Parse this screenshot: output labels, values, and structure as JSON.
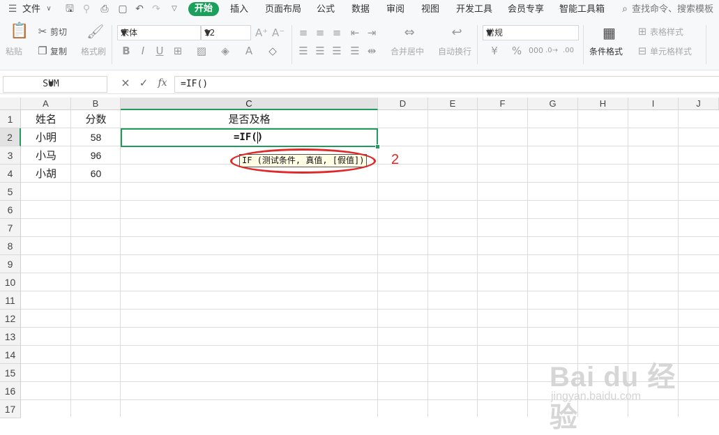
{
  "menu": {
    "file_label": "文件",
    "tabs": [
      "开始",
      "插入",
      "页面布局",
      "公式",
      "数据",
      "审阅",
      "视图",
      "开发工具",
      "会员专享",
      "智能工具箱"
    ],
    "search_placeholder": "查找命令、搜索模板"
  },
  "ribbon": {
    "paste": "粘贴",
    "cut": "剪切",
    "copy": "复制",
    "format_painter": "格式刷",
    "font_name": "宋体",
    "font_size": "12",
    "merge_center": "合并居中",
    "wrap_text": "自动换行",
    "number_format": "常规",
    "conditional_format": "条件格式",
    "table_style": "表格样式",
    "cell_style": "单元格样式"
  },
  "formula_bar": {
    "name_box": "SUM",
    "cancel_icon": "×",
    "enter_icon": "✓",
    "fx_icon": "fx",
    "content": "=IF()"
  },
  "sheet": {
    "columns": [
      "A",
      "B",
      "C",
      "D",
      "E",
      "F",
      "G",
      "H",
      "I",
      "J"
    ],
    "selected_column": "C",
    "rows": [
      "1",
      "2",
      "3",
      "4",
      "5",
      "6",
      "7",
      "8",
      "9",
      "10",
      "11",
      "12",
      "13",
      "14",
      "15",
      "16",
      "17"
    ],
    "selected_row": "2",
    "cells": {
      "A1": "姓名",
      "B1": "分数",
      "C1": "是否及格",
      "A2": "小明",
      "B2": "58",
      "A3": "小马",
      "B3": "96",
      "A4": "小胡",
      "B4": "60"
    },
    "editing_text": "=IF()",
    "tooltip": "IF (测试条件, 真值, [假值])"
  },
  "annotation": {
    "number": "2",
    "color": "#e02828"
  },
  "watermark": {
    "brand": "Bai du 经验",
    "url": "jingyan.baidu.com"
  },
  "colors": {
    "accent_green": "#1aa05a",
    "selection_green": "#1f9b5c"
  }
}
